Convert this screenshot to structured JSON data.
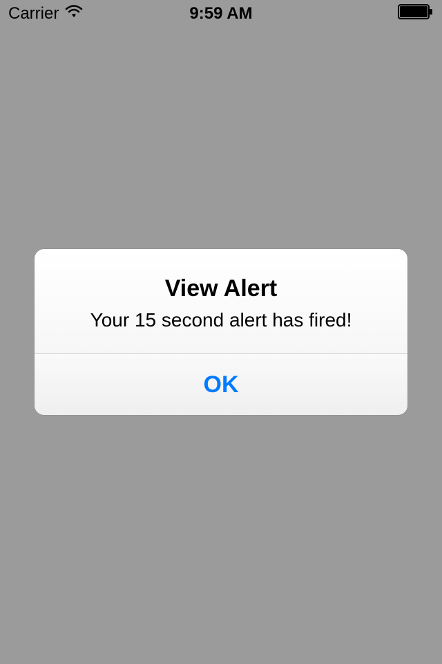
{
  "status_bar": {
    "carrier": "Carrier",
    "time": "9:59 AM"
  },
  "alert": {
    "title": "View Alert",
    "message": "Your 15 second alert has fired!",
    "button_label": "OK"
  }
}
